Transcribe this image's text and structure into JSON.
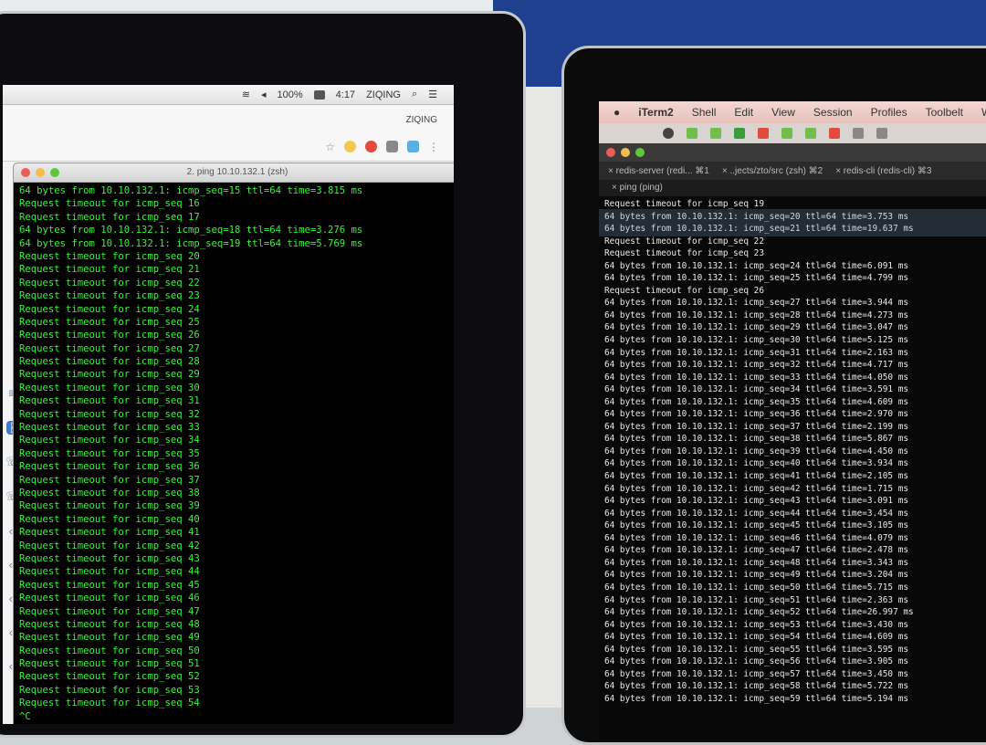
{
  "left": {
    "menubar": {
      "battery": "100%",
      "time": "4:17",
      "user": "ZIQING"
    },
    "browser_user": "ZIQING",
    "terminal": {
      "title": "2. ping 10.10.132.1 (zsh)",
      "lines": [
        "64 bytes from 10.10.132.1: icmp_seq=15 ttl=64 time=3.815 ms",
        "Request timeout for icmp_seq 16",
        "Request timeout for icmp_seq 17",
        "64 bytes from 10.10.132.1: icmp_seq=18 ttl=64 time=3.276 ms",
        "64 bytes from 10.10.132.1: icmp_seq=19 ttl=64 time=5.769 ms",
        "Request timeout for icmp_seq 20",
        "Request timeout for icmp_seq 21",
        "Request timeout for icmp_seq 22",
        "Request timeout for icmp_seq 23",
        "Request timeout for icmp_seq 24",
        "Request timeout for icmp_seq 25",
        "Request timeout for icmp_seq 26",
        "Request timeout for icmp_seq 27",
        "Request timeout for icmp_seq 28",
        "Request timeout for icmp_seq 29",
        "Request timeout for icmp_seq 30",
        "Request timeout for icmp_seq 31",
        "Request timeout for icmp_seq 32",
        "Request timeout for icmp_seq 33",
        "Request timeout for icmp_seq 34",
        "Request timeout for icmp_seq 35",
        "Request timeout for icmp_seq 36",
        "Request timeout for icmp_seq 37",
        "Request timeout for icmp_seq 38",
        "Request timeout for icmp_seq 39",
        "Request timeout for icmp_seq 40",
        "Request timeout for icmp_seq 41",
        "Request timeout for icmp_seq 42",
        "Request timeout for icmp_seq 43",
        "Request timeout for icmp_seq 44",
        "Request timeout for icmp_seq 45",
        "Request timeout for icmp_seq 46",
        "Request timeout for icmp_seq 47",
        "Request timeout for icmp_seq 48",
        "Request timeout for icmp_seq 49",
        "Request timeout for icmp_seq 50",
        "Request timeout for icmp_seq 51",
        "Request timeout for icmp_seq 52",
        "Request timeout for icmp_seq 53",
        "Request timeout for icmp_seq 54",
        "^C"
      ]
    }
  },
  "right": {
    "menubar": [
      "iTerm2",
      "Shell",
      "Edit",
      "View",
      "Session",
      "Profiles",
      "Toolbelt",
      "Windo"
    ],
    "tabs": [
      "redis-server (redi... ⌘1",
      "..jects/zto/src (zsh)  ⌘2",
      "redis-cli (redis-cli) ⌘3"
    ],
    "subtab": "ping (ping)",
    "lines": [
      "Request timeout for icmp_seq 19",
      "64 bytes from 10.10.132.1: icmp_seq=20 ttl=64 time=3.753 ms",
      "64 bytes from 10.10.132.1: icmp_seq=21 ttl=64 time=19.637 ms",
      "Request timeout for icmp_seq 22",
      "Request timeout for icmp_seq 23",
      "64 bytes from 10.10.132.1: icmp_seq=24 ttl=64 time=6.091 ms",
      "64 bytes from 10.10.132.1: icmp_seq=25 ttl=64 time=4.799 ms",
      "Request timeout for icmp_seq 26",
      "64 bytes from 10.10.132.1: icmp_seq=27 ttl=64 time=3.944 ms",
      "64 bytes from 10.10.132.1: icmp_seq=28 ttl=64 time=4.273 ms",
      "64 bytes from 10.10.132.1: icmp_seq=29 ttl=64 time=3.047 ms",
      "64 bytes from 10.10.132.1: icmp_seq=30 ttl=64 time=5.125 ms",
      "64 bytes from 10.10.132.1: icmp_seq=31 ttl=64 time=2.163 ms",
      "64 bytes from 10.10.132.1: icmp_seq=32 ttl=64 time=4.717 ms",
      "64 bytes from 10.10.132.1: icmp_seq=33 ttl=64 time=4.050 ms",
      "64 bytes from 10.10.132.1: icmp_seq=34 ttl=64 time=3.591 ms",
      "64 bytes from 10.10.132.1: icmp_seq=35 ttl=64 time=4.609 ms",
      "64 bytes from 10.10.132.1: icmp_seq=36 ttl=64 time=2.970 ms",
      "64 bytes from 10.10.132.1: icmp_seq=37 ttl=64 time=2.199 ms",
      "64 bytes from 10.10.132.1: icmp_seq=38 ttl=64 time=5.867 ms",
      "64 bytes from 10.10.132.1: icmp_seq=39 ttl=64 time=4.450 ms",
      "64 bytes from 10.10.132.1: icmp_seq=40 ttl=64 time=3.934 ms",
      "64 bytes from 10.10.132.1: icmp_seq=41 ttl=64 time=2.105 ms",
      "64 bytes from 10.10.132.1: icmp_seq=42 ttl=64 time=1.715 ms",
      "64 bytes from 10.10.132.1: icmp_seq=43 ttl=64 time=3.091 ms",
      "64 bytes from 10.10.132.1: icmp_seq=44 ttl=64 time=3.454 ms",
      "64 bytes from 10.10.132.1: icmp_seq=45 ttl=64 time=3.105 ms",
      "64 bytes from 10.10.132.1: icmp_seq=46 ttl=64 time=4.079 ms",
      "64 bytes from 10.10.132.1: icmp_seq=47 ttl=64 time=2.478 ms",
      "64 bytes from 10.10.132.1: icmp_seq=48 ttl=64 time=3.343 ms",
      "64 bytes from 10.10.132.1: icmp_seq=49 ttl=64 time=3.204 ms",
      "64 bytes from 10.10.132.1: icmp_seq=50 ttl=64 time=5.715 ms",
      "64 bytes from 10.10.132.1: icmp_seq=51 ttl=64 time=2.363 ms",
      "64 bytes from 10.10.132.1: icmp_seq=52 ttl=64 time=26.997 ms",
      "64 bytes from 10.10.132.1: icmp_seq=53 ttl=64 time=3.430 ms",
      "64 bytes from 10.10.132.1: icmp_seq=54 ttl=64 time=4.609 ms",
      "64 bytes from 10.10.132.1: icmp_seq=55 ttl=64 time=3.595 ms",
      "64 bytes from 10.10.132.1: icmp_seq=56 ttl=64 time=3.905 ms",
      "64 bytes from 10.10.132.1: icmp_seq=57 ttl=64 time=3.450 ms",
      "64 bytes from 10.10.132.1: icmp_seq=58 ttl=64 time=5.722 ms",
      "64 bytes from 10.10.132.1: icmp_seq=59 ttl=64 time=5.194 ms"
    ]
  },
  "colors": {
    "left_terminal_text": "#3cf03c",
    "right_terminal_text": "#e9e9e9",
    "wall_blue": "#1f3f8f"
  }
}
